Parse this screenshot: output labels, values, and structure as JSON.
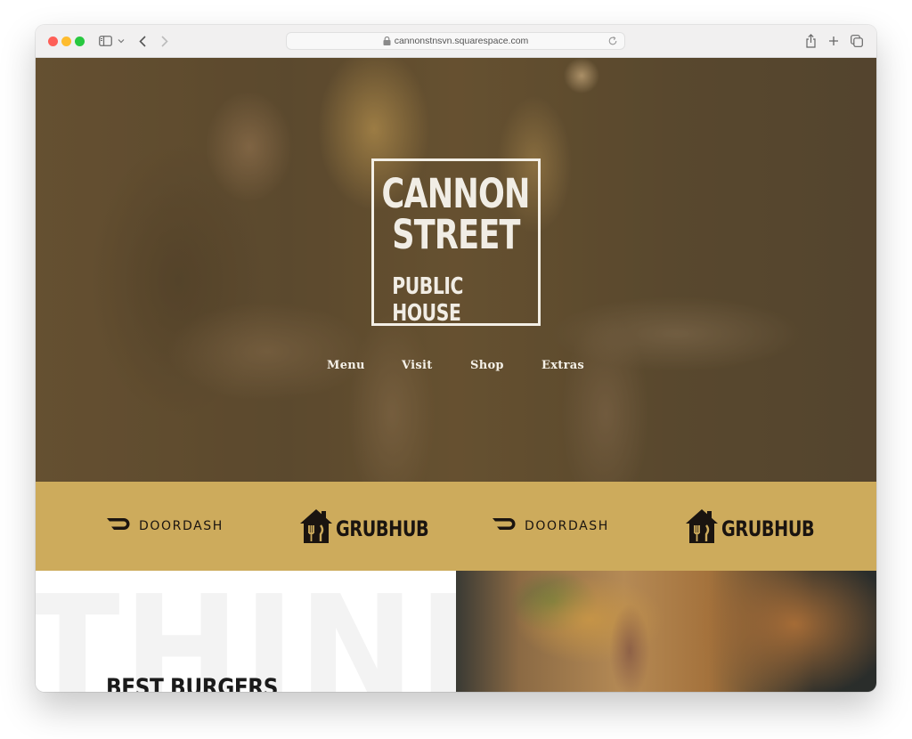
{
  "browser": {
    "url": "cannonstnsvn.squarespace.com",
    "icons": {
      "sidebar": "sidebar-icon",
      "chevron": "chevron-down-icon",
      "back": "chevron-left-icon",
      "forward": "chevron-right-icon",
      "lock": "lock-icon",
      "reload": "reload-icon",
      "share": "share-icon",
      "new_tab": "plus-icon",
      "tabs": "tabs-overview-icon"
    }
  },
  "hero": {
    "logo": {
      "line1": "CANNON",
      "line2": "STREET",
      "line3": "PUBLIC HOUSE",
      "accent_color": "#c9a85a"
    },
    "nav": [
      {
        "label": "Menu"
      },
      {
        "label": "Visit"
      },
      {
        "label": "Shop"
      },
      {
        "label": "Extras"
      }
    ]
  },
  "delivery": {
    "background_color": "#cdab5c",
    "partners": [
      {
        "name": "DOORDASH"
      },
      {
        "name": "GRUBHUB"
      },
      {
        "name": "DOORDASH"
      },
      {
        "name": "GRUBHUB"
      }
    ]
  },
  "feature": {
    "background_word": "THINK",
    "heading": "BEST BURGERS"
  }
}
